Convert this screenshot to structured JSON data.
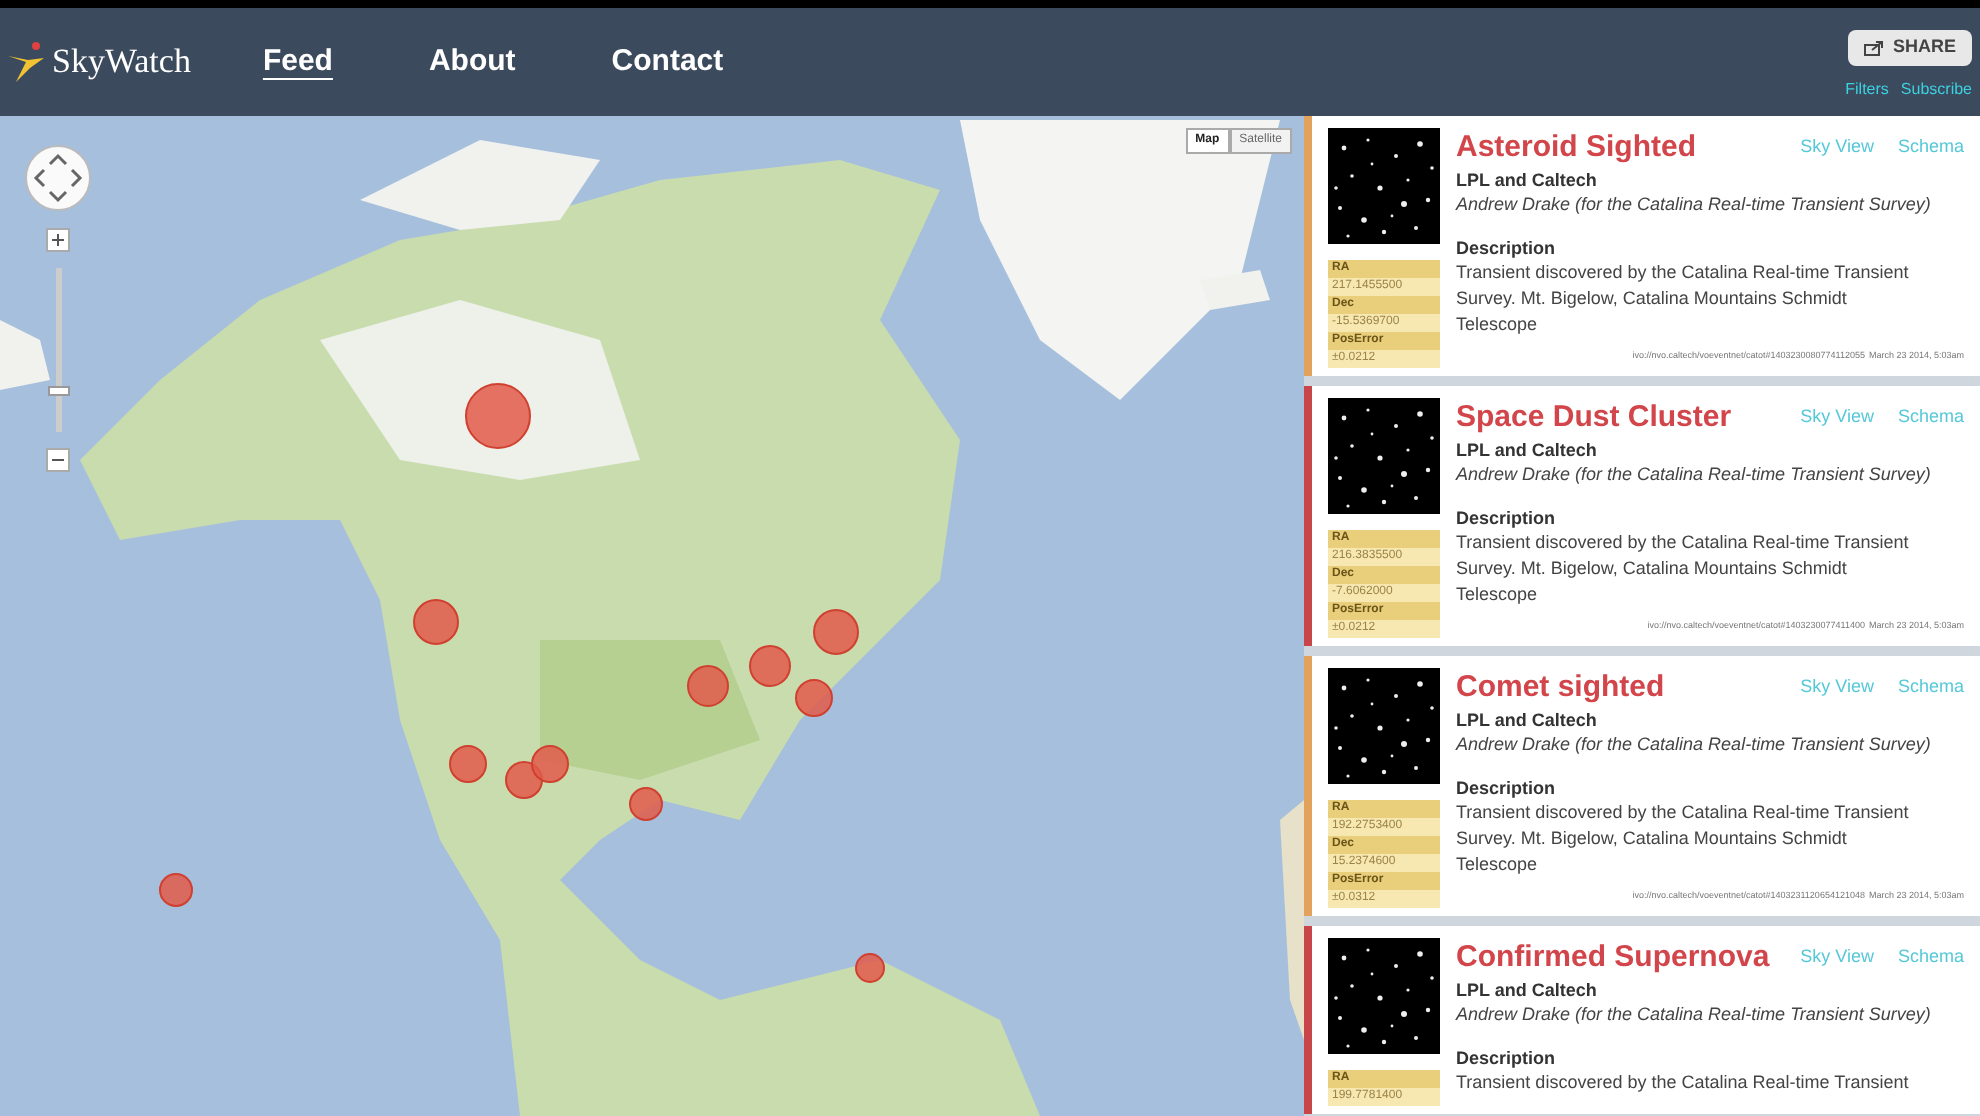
{
  "header": {
    "logo": "SkyWatch",
    "nav": [
      {
        "label": "Feed",
        "selected": true
      },
      {
        "label": "About",
        "selected": false
      },
      {
        "label": "Contact",
        "selected": false
      }
    ],
    "share_button": "SHARE",
    "links": [
      "Filters",
      "Subscribe"
    ]
  },
  "map": {
    "map_types": [
      {
        "label": "Map",
        "selected": true
      },
      {
        "label": "Satellite",
        "selected": false
      }
    ],
    "zoom_slider": {
      "level": 0.26
    }
  },
  "feed": [
    {
      "title": "Asteroid Sighted",
      "color": "#e3a25c",
      "links": [
        "Sky View",
        "Schema"
      ],
      "source": "LPL and Caltech",
      "author": "Andrew Drake (for the Catalina Real-time Transient Survey)",
      "description_label": "Description",
      "description": "Transient discovered by the Catalina Real-time Transient Survey. Mt. Bigelow, Catalina Mountains Schmidt Telescope",
      "coords": [
        {
          "label": "RA",
          "value": "217.1455500"
        },
        {
          "label": "Dec",
          "value": "-15.5369700"
        },
        {
          "label": "PosError",
          "value": "±0.0212"
        }
      ],
      "uri": "ivo://nvo.caltech/voeventnet/catot#1403230080774112055",
      "date": "March 23 2014, 5:03am"
    },
    {
      "title": "Space Dust Cluster",
      "color": "#c8464a",
      "links": [
        "Sky View",
        "Schema"
      ],
      "source": "LPL and Caltech",
      "author": "Andrew Drake (for the Catalina Real-time Transient Survey)",
      "description_label": "Description",
      "description": "Transient discovered by the Catalina Real-time Transient Survey. Mt. Bigelow, Catalina Mountains Schmidt Telescope",
      "coords": [
        {
          "label": "RA",
          "value": "216.3835500"
        },
        {
          "label": "Dec",
          "value": "-7.6062000"
        },
        {
          "label": "PosError",
          "value": "±0.0212"
        }
      ],
      "uri": "ivo://nvo.caltech/voeventnet/catot#1403230077411400",
      "date": "March 23 2014, 5:03am"
    },
    {
      "title": "Comet sighted",
      "color": "#e3a25c",
      "links": [
        "Sky View",
        "Schema"
      ],
      "source": "LPL and Caltech",
      "author": "Andrew Drake (for the Catalina Real-time Transient Survey)",
      "description_label": "Description",
      "description": "Transient discovered by the Catalina Real-time Transient Survey. Mt. Bigelow, Catalina Mountains Schmidt Telescope",
      "coords": [
        {
          "label": "RA",
          "value": "192.2753400"
        },
        {
          "label": "Dec",
          "value": "15.2374600"
        },
        {
          "label": "PosError",
          "value": "±0.0312"
        }
      ],
      "uri": "ivo://nvo.caltech/voeventnet/catot#1403231120654121048",
      "date": "March 23 2014, 5:03am"
    },
    {
      "title": "Confirmed Supernova",
      "color": "#c8464a",
      "links": [
        "Sky View",
        "Schema"
      ],
      "source": "LPL and Caltech",
      "author": "Andrew Drake (for the Catalina Real-time Transient Survey)",
      "description_label": "Description",
      "description": "Transient discovered by the Catalina Real-time Transient",
      "coords": [
        {
          "label": "RA",
          "value": "199.7781400"
        }
      ]
    }
  ]
}
